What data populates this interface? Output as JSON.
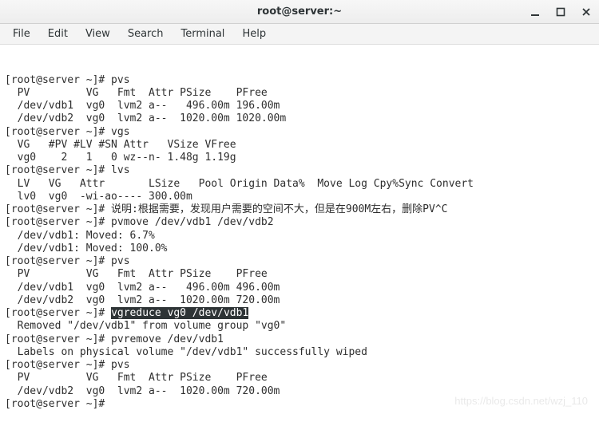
{
  "window": {
    "title": "root@server:~"
  },
  "menubar": {
    "items": [
      "File",
      "Edit",
      "View",
      "Search",
      "Terminal",
      "Help"
    ]
  },
  "terminal": {
    "prompt": "[root@server ~]# ",
    "lines": [
      {
        "t": "p",
        "cmd": "pvs"
      },
      {
        "t": "o",
        "text": "  PV         VG   Fmt  Attr PSize    PFree  "
      },
      {
        "t": "o",
        "text": "  /dev/vdb1  vg0  lvm2 a--   496.00m 196.00m"
      },
      {
        "t": "o",
        "text": "  /dev/vdb2  vg0  lvm2 a--  1020.00m 1020.00m"
      },
      {
        "t": "p",
        "cmd": "vgs"
      },
      {
        "t": "o",
        "text": "  VG   #PV #LV #SN Attr   VSize VFree"
      },
      {
        "t": "o",
        "text": "  vg0    2   1   0 wz--n- 1.48g 1.19g"
      },
      {
        "t": "p",
        "cmd": "lvs"
      },
      {
        "t": "o",
        "text": "  LV   VG   Attr       LSize   Pool Origin Data%  Move Log Cpy%Sync Convert"
      },
      {
        "t": "o",
        "text": "  lv0  vg0  -wi-ao---- 300.00m                                              "
      },
      {
        "t": "p",
        "cmd": "说明:根据需要，发现用户需要的空间不大，但是在900M左右，删除PV^C"
      },
      {
        "t": "p",
        "cmd": "pvmove /dev/vdb1 /dev/vdb2"
      },
      {
        "t": "o",
        "text": "  /dev/vdb1: Moved: 6.7%"
      },
      {
        "t": "o",
        "text": "  /dev/vdb1: Moved: 100.0%"
      },
      {
        "t": "p",
        "cmd": "pvs"
      },
      {
        "t": "o",
        "text": "  PV         VG   Fmt  Attr PSize    PFree  "
      },
      {
        "t": "o",
        "text": "  /dev/vdb1  vg0  lvm2 a--   496.00m 496.00m"
      },
      {
        "t": "o",
        "text": "  /dev/vdb2  vg0  lvm2 a--  1020.00m 720.00m"
      },
      {
        "t": "ph",
        "cmd": "vgreduce vg0 /dev/vdb1"
      },
      {
        "t": "o",
        "text": "  Removed \"/dev/vdb1\" from volume group \"vg0\""
      },
      {
        "t": "p",
        "cmd": "pvremove /dev/vdb1"
      },
      {
        "t": "o",
        "text": "  Labels on physical volume \"/dev/vdb1\" successfully wiped"
      },
      {
        "t": "p",
        "cmd": "pvs"
      },
      {
        "t": "o",
        "text": "  PV         VG   Fmt  Attr PSize    PFree  "
      },
      {
        "t": "o",
        "text": "  /dev/vdb2  vg0  lvm2 a--  1020.00m 720.00m"
      },
      {
        "t": "p",
        "cmd": ""
      }
    ]
  },
  "watermark": "https://blog.csdn.net/wzj_110"
}
